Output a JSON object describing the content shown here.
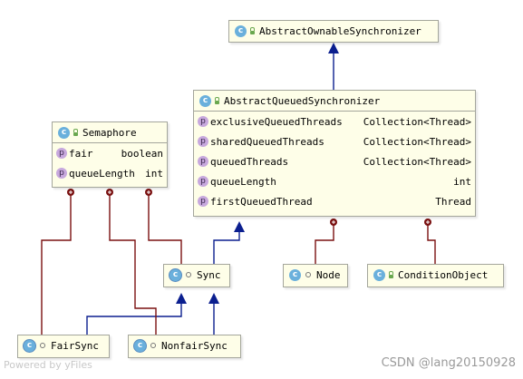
{
  "classes": {
    "aos": {
      "name": "AbstractOwnableSynchronizer",
      "icon": "c"
    },
    "aqs": {
      "name": "AbstractQueuedSynchronizer",
      "icon": "c",
      "fields": [
        {
          "name": "exclusiveQueuedThreads",
          "type": "Collection<Thread>"
        },
        {
          "name": "sharedQueuedThreads",
          "type": "Collection<Thread>"
        },
        {
          "name": "queuedThreads",
          "type": "Collection<Thread>"
        },
        {
          "name": "queueLength",
          "type": "int"
        },
        {
          "name": "firstQueuedThread",
          "type": "Thread"
        }
      ]
    },
    "semaphore": {
      "name": "Semaphore",
      "icon": "c",
      "fields": [
        {
          "name": "fair",
          "type": "boolean"
        },
        {
          "name": "queueLength",
          "type": "int"
        }
      ]
    },
    "sync": {
      "name": "Sync",
      "icon": "c"
    },
    "node": {
      "name": "Node",
      "icon": "c"
    },
    "condition": {
      "name": "ConditionObject",
      "icon": "c"
    },
    "fairsync": {
      "name": "FairSync",
      "icon": "c"
    },
    "nonfair": {
      "name": "NonfairSync",
      "icon": "c"
    }
  },
  "property_icon": "p",
  "colors": {
    "inheritance": "#0b1f8f",
    "inner": "#7a1010",
    "box_fill": "#fefee8",
    "box_border": "#a4a69c"
  },
  "footer": {
    "left": "Powered by yFiles",
    "right": "CSDN @lang20150928"
  }
}
